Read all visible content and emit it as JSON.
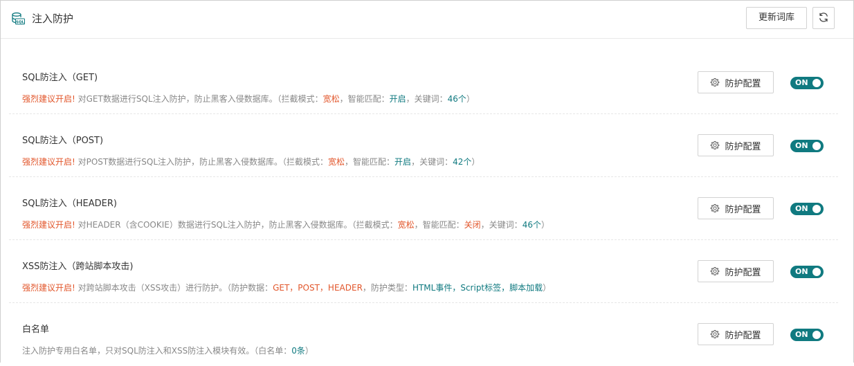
{
  "header": {
    "icon": "sql-database-icon",
    "title": "注入防护",
    "update_button": "更新词库",
    "refresh_icon": "refresh-icon"
  },
  "colors": {
    "accent": "#107a80",
    "warning": "#e2562b",
    "muted": "#888888",
    "text": "#333333"
  },
  "rows": [
    {
      "title": "SQL防注入（GET)",
      "desc": [
        {
          "text": "强烈建议开启!",
          "style": "red"
        },
        {
          "text": " 对GET数据进行SQL注入防护，防止黑客入侵数据库。（拦截模式：",
          "style": "plain"
        },
        {
          "text": "宽松",
          "style": "red"
        },
        {
          "text": "，智能匹配：",
          "style": "plain"
        },
        {
          "text": "开启",
          "style": "teal"
        },
        {
          "text": "，关键词：",
          "style": "plain"
        },
        {
          "text": "46个",
          "style": "teal"
        },
        {
          "text": "）",
          "style": "plain"
        }
      ],
      "config_button": "防护配置",
      "toggle": "ON"
    },
    {
      "title": "SQL防注入（POST)",
      "desc": [
        {
          "text": "强烈建议开启!",
          "style": "red"
        },
        {
          "text": " 对POST数据进行SQL注入防护，防止黑客入侵数据库。（拦截模式：",
          "style": "plain"
        },
        {
          "text": "宽松",
          "style": "red"
        },
        {
          "text": "，智能匹配：",
          "style": "plain"
        },
        {
          "text": "开启",
          "style": "teal"
        },
        {
          "text": "，关键词：",
          "style": "plain"
        },
        {
          "text": "42个",
          "style": "teal"
        },
        {
          "text": "）",
          "style": "plain"
        }
      ],
      "config_button": "防护配置",
      "toggle": "ON"
    },
    {
      "title": "SQL防注入（HEADER)",
      "desc": [
        {
          "text": "强烈建议开启!",
          "style": "red"
        },
        {
          "text": " 对HEADER（含COOKIE）数据进行SQL注入防护，防止黑客入侵数据库。（拦截模式：",
          "style": "plain"
        },
        {
          "text": "宽松",
          "style": "red"
        },
        {
          "text": "，智能匹配：",
          "style": "plain"
        },
        {
          "text": "关闭",
          "style": "red"
        },
        {
          "text": "，关键词：",
          "style": "plain"
        },
        {
          "text": "46个",
          "style": "teal"
        },
        {
          "text": "）",
          "style": "plain"
        }
      ],
      "config_button": "防护配置",
      "toggle": "ON"
    },
    {
      "title": "XSS防注入（跨站脚本攻击)",
      "desc": [
        {
          "text": "强烈建议开启!",
          "style": "red"
        },
        {
          "text": " 对跨站脚本攻击（XSS攻击）进行防护。（防护数据：",
          "style": "plain"
        },
        {
          "text": "GET，POST，HEADER",
          "style": "red"
        },
        {
          "text": "，防护类型：",
          "style": "plain"
        },
        {
          "text": "HTML事件，Script标签，脚本加载",
          "style": "teal"
        },
        {
          "text": "）",
          "style": "plain"
        }
      ],
      "config_button": "防护配置",
      "toggle": "ON"
    },
    {
      "title": "白名单",
      "desc": [
        {
          "text": "注入防护专用白名单，只对SQL防注入和XSS防注入模块有效。（白名单：",
          "style": "plain"
        },
        {
          "text": "0条",
          "style": "teal"
        },
        {
          "text": "）",
          "style": "plain"
        }
      ],
      "config_button": "防护配置",
      "toggle": "ON"
    }
  ]
}
